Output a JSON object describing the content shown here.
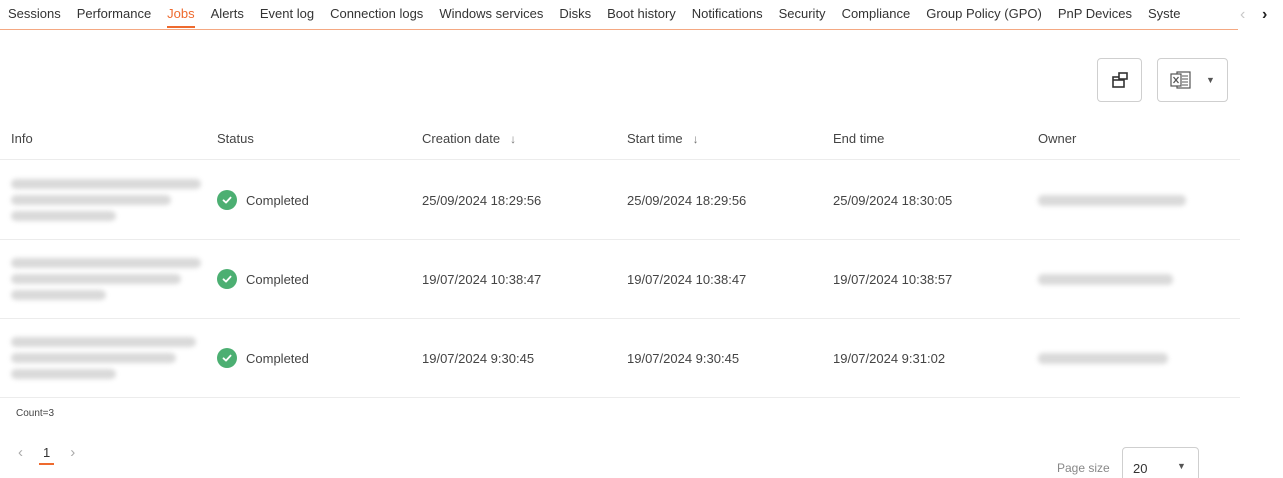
{
  "tabs": {
    "items": [
      {
        "label": "Sessions",
        "active": false
      },
      {
        "label": "Performance",
        "active": false
      },
      {
        "label": "Jobs",
        "active": true
      },
      {
        "label": "Alerts",
        "active": false
      },
      {
        "label": "Event log",
        "active": false
      },
      {
        "label": "Connection logs",
        "active": false
      },
      {
        "label": "Windows services",
        "active": false
      },
      {
        "label": "Disks",
        "active": false
      },
      {
        "label": "Boot history",
        "active": false
      },
      {
        "label": "Notifications",
        "active": false
      },
      {
        "label": "Security",
        "active": false
      },
      {
        "label": "Compliance",
        "active": false
      },
      {
        "label": "Group Policy (GPO)",
        "active": false
      },
      {
        "label": "PnP Devices",
        "active": false
      },
      {
        "label": "Syste",
        "active": false
      }
    ],
    "prev_glyph": "‹",
    "next_glyph": "›",
    "accent_color": "#ee6a2e"
  },
  "toolbar": {
    "share_icon": "external-window-icon",
    "export_icon": "excel-icon"
  },
  "table": {
    "columns": [
      {
        "label": "Info",
        "sort": ""
      },
      {
        "label": "Status",
        "sort": ""
      },
      {
        "label": "Creation date",
        "sort": "↓"
      },
      {
        "label": "Start time",
        "sort": "↓"
      },
      {
        "label": "End time",
        "sort": ""
      },
      {
        "label": "Owner",
        "sort": ""
      }
    ],
    "rows": [
      {
        "status": "Completed",
        "creation_date": "25/09/2024 18:29:56",
        "start_time": "25/09/2024 18:29:56",
        "end_time": "25/09/2024 18:30:05"
      },
      {
        "status": "Completed",
        "creation_date": "19/07/2024 10:38:47",
        "start_time": "19/07/2024 10:38:47",
        "end_time": "19/07/2024 10:38:57"
      },
      {
        "status": "Completed",
        "creation_date": "19/07/2024 9:30:45",
        "start_time": "19/07/2024 9:30:45",
        "end_time": "19/07/2024 9:31:02"
      }
    ],
    "status_color": "#4caf72"
  },
  "footer": {
    "count_text": "Count=3",
    "current_page": "1",
    "page_size_label": "Page size",
    "page_size_value": "20"
  }
}
